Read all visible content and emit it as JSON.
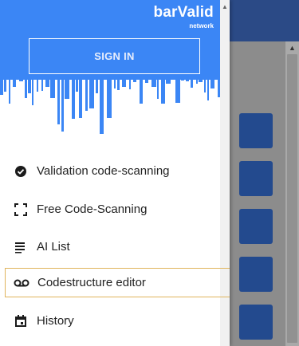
{
  "header": {
    "brand": "barValid",
    "brand_sub": "network",
    "signin_label": "SIGN IN",
    "color": "#3b86f5"
  },
  "menu": {
    "items": [
      {
        "label": "Validation code-scanning",
        "icon": "check-circle-icon"
      },
      {
        "label": "Free Code-Scanning",
        "icon": "scan-frame-icon"
      },
      {
        "label": "AI List",
        "icon": "list-icon"
      },
      {
        "label": "Codestructure editor",
        "icon": "voicemail-icon",
        "selected": true
      },
      {
        "label": "History",
        "icon": "calendar-icon"
      }
    ]
  },
  "scroll_up_glyph": "▲"
}
